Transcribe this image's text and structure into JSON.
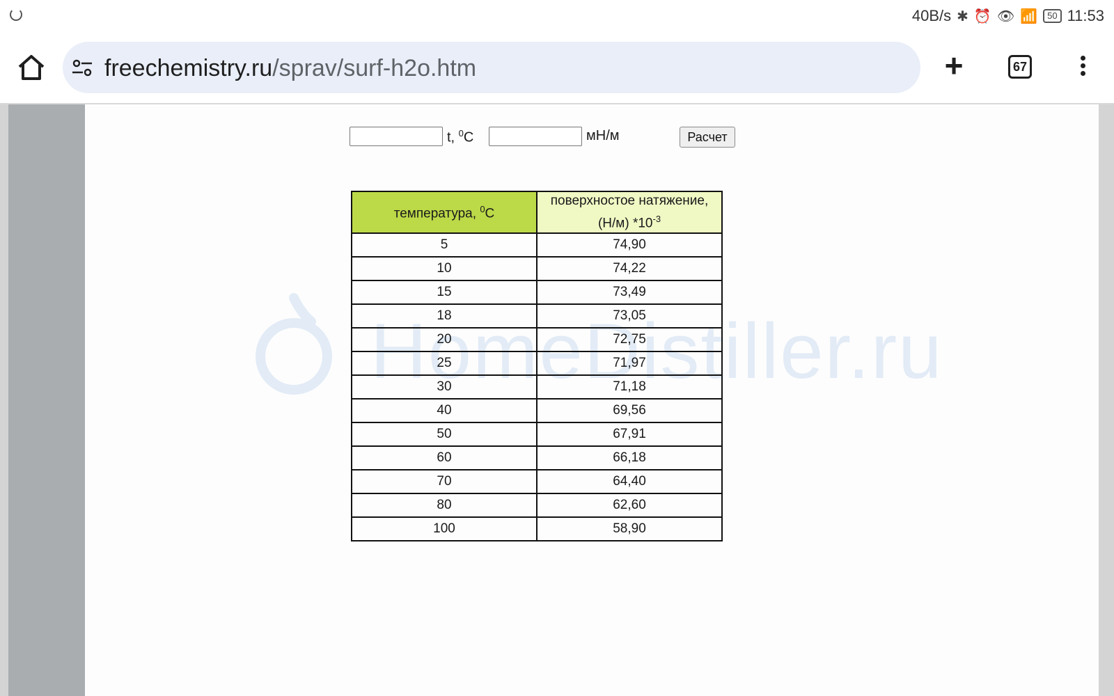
{
  "status_bar": {
    "net_speed": "40B/s",
    "battery": "50",
    "time": "11:53"
  },
  "toolbar": {
    "url_host": "freechemistry.ru",
    "url_path": "/sprav/surf-h2o.htm",
    "tab_count": "67"
  },
  "calculator": {
    "temp_unit_prefix": "t, ",
    "temp_unit_sup": "0",
    "temp_unit_suffix": "C",
    "tension_unit": "мН/м",
    "button_label": "Расчет"
  },
  "watermark": {
    "text": "HomeDistiller.ru"
  },
  "table": {
    "col1_header": "температура, ",
    "col1_header_sup": "0",
    "col1_header_suffix": "C",
    "col2_header_line1": "поверхностое натяжение,",
    "col2_header_line2": "(Н/м) *10",
    "col2_header_sup": "-3",
    "rows": [
      {
        "t": "5",
        "v": "74,90"
      },
      {
        "t": "10",
        "v": "74,22"
      },
      {
        "t": "15",
        "v": "73,49"
      },
      {
        "t": "18",
        "v": "73,05"
      },
      {
        "t": "20",
        "v": "72,75"
      },
      {
        "t": "25",
        "v": "71,97"
      },
      {
        "t": "30",
        "v": "71,18"
      },
      {
        "t": "40",
        "v": "69,56"
      },
      {
        "t": "50",
        "v": "67,91"
      },
      {
        "t": "60",
        "v": "66,18"
      },
      {
        "t": "70",
        "v": "64,40"
      },
      {
        "t": "80",
        "v": "62,60"
      },
      {
        "t": "100",
        "v": "58,90"
      }
    ]
  }
}
